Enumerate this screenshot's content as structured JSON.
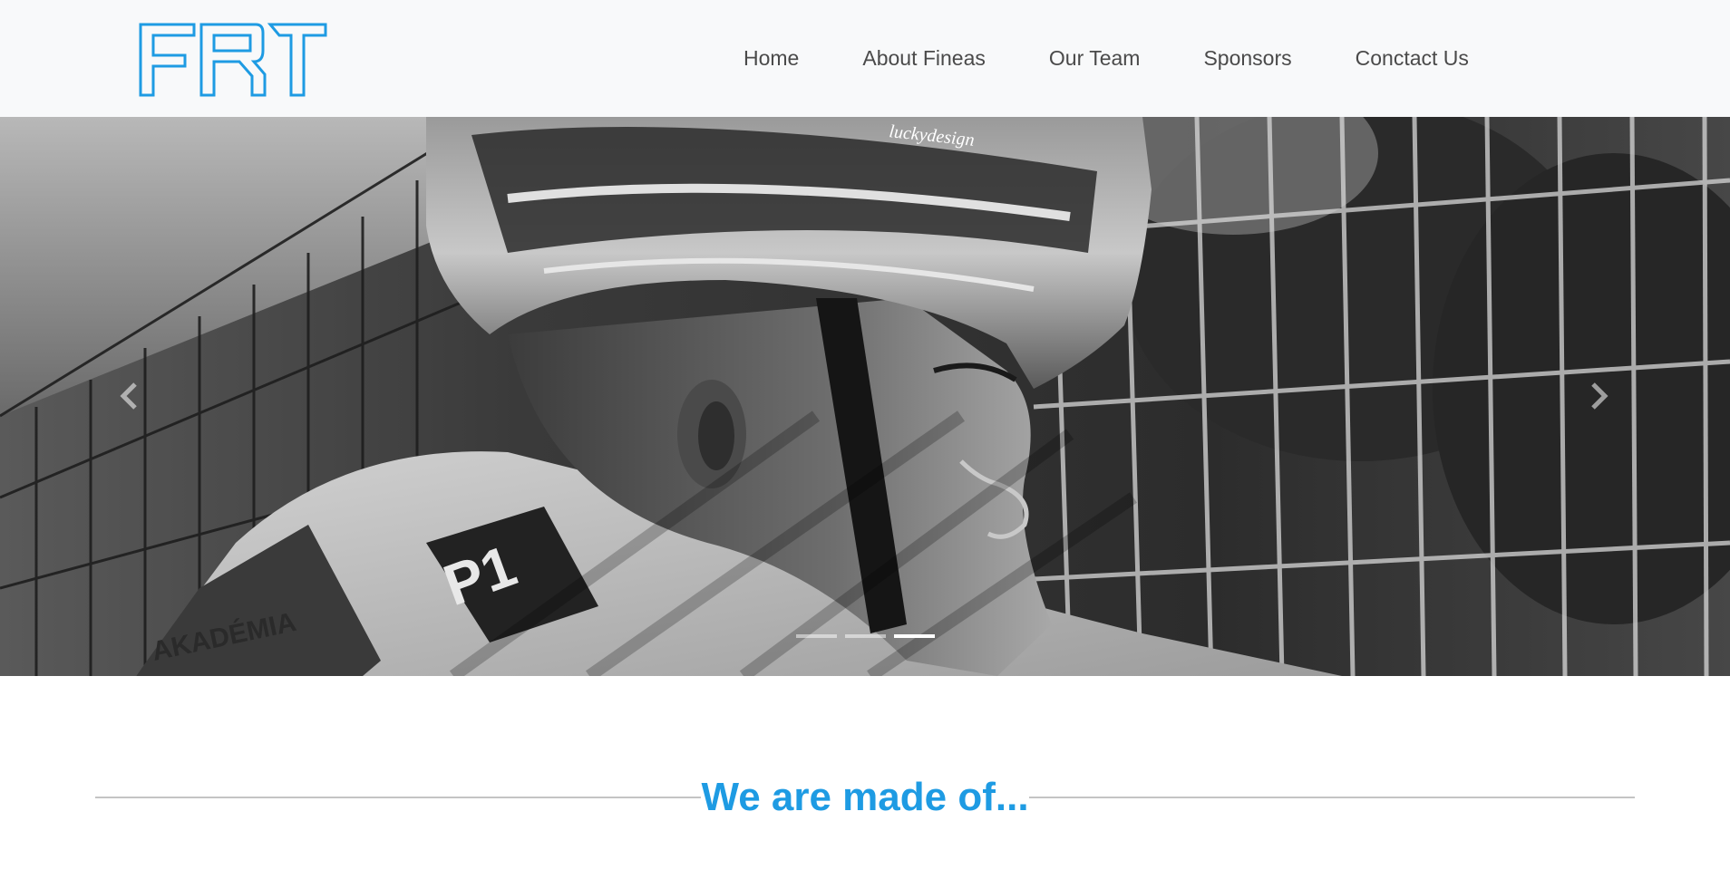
{
  "header": {
    "logo_text": "FRT",
    "nav": [
      {
        "label": "Home"
      },
      {
        "label": "About Fineas"
      },
      {
        "label": "Our Team"
      },
      {
        "label": "Sponsors"
      },
      {
        "label": "Conctact Us"
      }
    ]
  },
  "carousel": {
    "prev_icon": "chevron-left-icon",
    "next_icon": "chevron-right-icon",
    "slide_count": 3,
    "active_slide": 3,
    "image_text": {
      "helmet_brand": "luckydesign",
      "suit_patch": "P1",
      "suit_text": "AKADÉMIA"
    }
  },
  "section": {
    "heading": "We are made of..."
  },
  "colors": {
    "accent": "#1e9be3",
    "nav_text": "#4a4a4a",
    "navbar_bg": "#f8f9fa"
  }
}
